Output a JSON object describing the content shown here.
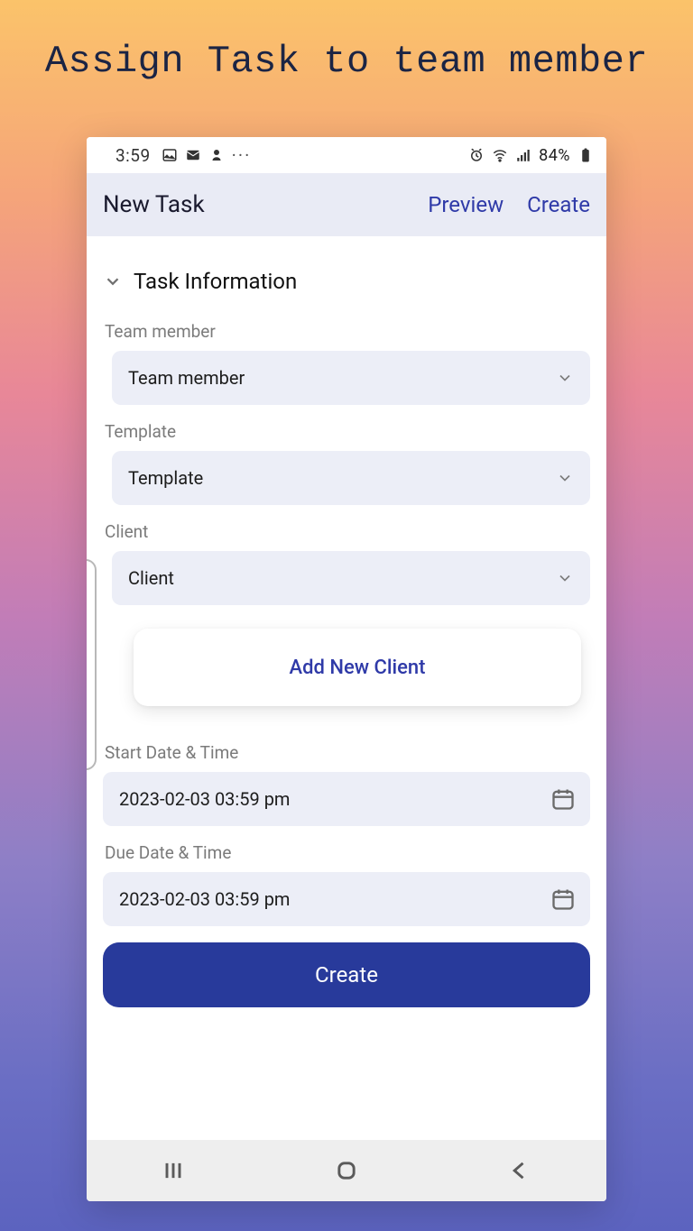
{
  "page": {
    "title": "Assign Task to team member"
  },
  "status": {
    "time": "3:59",
    "battery": "84%"
  },
  "header": {
    "title": "New Task",
    "preview": "Preview",
    "create": "Create"
  },
  "section": {
    "title": "Task Information"
  },
  "fields": {
    "team_member": {
      "label": "Team member",
      "value": "Team member"
    },
    "template": {
      "label": "Template",
      "value": "Template"
    },
    "client": {
      "label": "Client",
      "value": "Client"
    },
    "add_client": "Add New Client",
    "start": {
      "label": "Start Date & Time",
      "value": "2023-02-03 03:59 pm"
    },
    "due": {
      "label": "Due Date & Time",
      "value": "2023-02-03 03:59 pm"
    }
  },
  "buttons": {
    "create": "Create"
  }
}
